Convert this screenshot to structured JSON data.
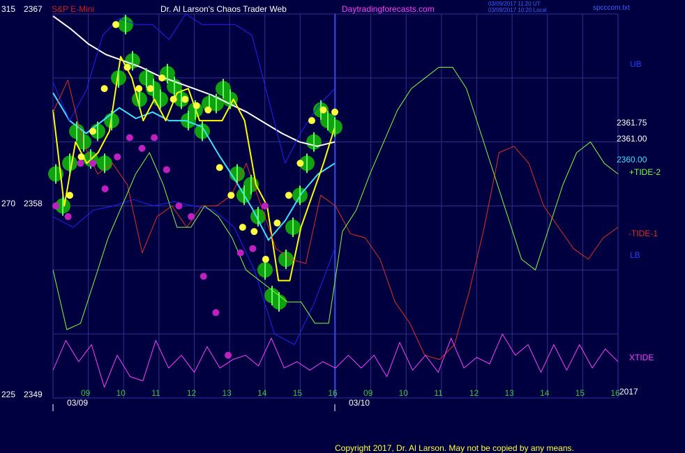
{
  "header": {
    "symbol": "S&P E-Mini",
    "title": "Dr. Al Larson's Chaos Trader Web",
    "site": "Daytradingforecasts.com",
    "stamp_line1": "03/09/2017 11:20 UT",
    "stamp_line2": "03/09/2017 10:20 Local",
    "file": "spcccom.txt",
    "colors": {
      "symbol": "#cc2020",
      "title": "#ffffff",
      "site": "#ff40ff",
      "stamp": "#4060ff",
      "file": "#4060ff"
    }
  },
  "footer": {
    "copyright": "Copyright 2017, Dr. Al Larson. May not be copied by any means."
  },
  "chart_data": {
    "type": "line",
    "y_left_labels": [
      {
        "label": "315",
        "price": "2367"
      },
      {
        "label": "270",
        "price": "2358"
      },
      {
        "label": "225",
        "price": "2349"
      }
    ],
    "ylim": [
      2349,
      2367
    ],
    "x_hours": [
      "09",
      "10",
      "11",
      "12",
      "13",
      "14",
      "15",
      "16",
      "09",
      "10",
      "11",
      "12",
      "13",
      "14",
      "15",
      "16"
    ],
    "x_dates": [
      "03/09",
      "03/10"
    ],
    "x_year": "2017",
    "price_labels": [
      {
        "text": "2361.75",
        "value": 2361.75,
        "color": "#ffffff"
      },
      {
        "text": "2361.00",
        "value": 2361.0,
        "color": "#ffffff"
      },
      {
        "text": "2360.00",
        "value": 2360.0,
        "color": "#40e0ff"
      }
    ],
    "right_labels": [
      {
        "text": "UB",
        "color": "#2040ff"
      },
      {
        "text": "+TIDE-2",
        "color": "#80ff40"
      },
      {
        "text": "-TIDE-1",
        "color": "#e03020"
      },
      {
        "text": "LB",
        "color": "#2040ff"
      },
      {
        "text": "XTIDE",
        "color": "#ff40ff"
      }
    ],
    "series": [
      {
        "color": "#ffffff",
        "values": [
          2366.9,
          2366.3,
          2365.6,
          2365.1,
          2364.8,
          2364.5,
          2364.1,
          2363.8,
          2363.5,
          2363.2,
          2362.8,
          2362.4,
          2361.9,
          2361.4,
          2361.0,
          2360.8,
          2361.0
        ]
      },
      {
        "color": "#40e0ff",
        "values": [
          2363.3,
          2362.0,
          2361.4,
          2362.0,
          2362.6,
          2362.1,
          2362.4,
          2362.0,
          2362.0,
          2361.7,
          2360.4,
          2359.2,
          2357.9,
          2356.4,
          2357.3,
          2358.6,
          2359.5,
          2360.0
        ]
      },
      {
        "color": "#ffff00",
        "values": [
          2362.5,
          2358.0,
          2361.0,
          2360.0,
          2360.5,
          2361.5,
          2365.0,
          2364.0,
          2362.0,
          2363.0,
          2362.0,
          2363.3,
          2363.5,
          2362.0,
          2362.0,
          2362.0,
          2363.0,
          2362.0,
          2359.0,
          2358.0,
          2354.5,
          2354.5,
          2357.0,
          2358.5,
          2360.0,
          2361.7
        ]
      },
      {
        "color": "#2020ff",
        "values": [
          2363.8,
          2362.0,
          2363.4,
          2366.0,
          2366.8,
          2366.5,
          2366.5,
          2365.8,
          2367.0,
          2366.5,
          2366.5,
          2366.5,
          2366.0,
          2363.0,
          2360.0,
          2361.5,
          2362.7,
          2363.5
        ]
      },
      {
        "color": "#2020ff",
        "values": [
          2357.5,
          2357.0,
          2357.8,
          2358.0,
          2358.3,
          2358.0,
          2358.2,
          2358.0,
          2357.8,
          2357.0,
          2355.0,
          2352.0,
          2351.5,
          2353.5,
          2356.0
        ]
      },
      {
        "color": "#e03020",
        "values": [
          2362.4,
          2363.9,
          2361.0,
          2359.5,
          2360.0,
          2359.0,
          2355.8,
          2357.5,
          2358.0,
          2357.0,
          2358.0,
          2358.0,
          2358.5,
          2360.0,
          2358.0,
          2356.0,
          2355.5,
          2355.3,
          2358.5,
          2358.0,
          2356.7,
          2356.5,
          2355.5,
          2353.5,
          2352.5,
          2351.0,
          2350.8,
          2351.5,
          2354.0,
          2357.0,
          2360.5,
          2360.8,
          2360.0,
          2358.0,
          2357.0,
          2356.0,
          2355.5,
          2356.5,
          2357.0
        ]
      },
      {
        "color": "#80ff40",
        "values": [
          2355.0,
          2352.2,
          2352.5,
          2354.5,
          2356.5,
          2358.0,
          2359.5,
          2360.5,
          2359.0,
          2357.0,
          2357.0,
          2358.0,
          2357.5,
          2356.5,
          2355.0,
          2354.5,
          2354.0,
          2353.5,
          2353.5,
          2352.5,
          2352.5,
          2356.8,
          2357.8,
          2359.5,
          2361.0,
          2362.5,
          2363.5,
          2364.0,
          2364.5,
          2364.5,
          2363.5,
          2361.5,
          2359.5,
          2357.5,
          2355.5,
          2355.0,
          2357.0,
          2359.0,
          2360.5,
          2361.0,
          2360.0,
          2359.5
        ]
      },
      {
        "color": "#ff40ff",
        "values": [
          2350.3,
          2351.7,
          2350.7,
          2351.5,
          2349.5,
          2351.0,
          2350.0,
          2349.8,
          2351.7,
          2350.4,
          2351.0,
          2350.2,
          2351.4,
          2350.4,
          2350.8,
          2351.0,
          2350.5,
          2351.8,
          2350.4,
          2350.7,
          2350.3,
          2350.7,
          2350.4,
          2351.0,
          2350.4,
          2351.0,
          2350.0,
          2351.6,
          2350.3,
          2351.0,
          2350.2,
          2351.8,
          2350.4,
          2350.9,
          2350.6,
          2352.0,
          2351.0,
          2351.5,
          2350.2,
          2351.5,
          2350.3,
          2351.5,
          2350.4,
          2351.3,
          2350.7
        ]
      }
    ],
    "price_bars": [
      2359.5,
      2358.0,
      2360.0,
      2361.5,
      2361.0,
      2360.2,
      2361.5,
      2360.0,
      2362.0,
      2364.0,
      2366.5,
      2364.8,
      2363.0,
      2364.0,
      2363.5,
      2363.0,
      2364.2,
      2363.6,
      2363.0,
      2362.0,
      2362.5,
      2361.5,
      2362.8,
      2362.8,
      2363.5,
      2363.0,
      2359.5,
      2358.5,
      2359.0,
      2357.5,
      2355.0,
      2353.8,
      2353.5,
      2355.5,
      2357.0,
      2358.5,
      2360.0,
      2361.0,
      2362.5,
      2362.0,
      2361.7
    ],
    "yellow_dots": [
      2358.5,
      2360.3,
      2361.5,
      2363.5,
      2366.5,
      2364.5,
      2363.5,
      2363.5,
      2364.0,
      2363.0,
      2363.0,
      2362.7,
      2362.5,
      2359.8,
      2358.5,
      2357.0,
      2356.8,
      2355.5,
      2357.2,
      2358.5,
      2360.0,
      2362.0,
      2362.5,
      2362.4
    ],
    "magenta_dots": [
      2358.0,
      2357.5,
      2360.0,
      2360.0,
      2358.8,
      2360.3,
      2361.2,
      2360.7,
      2361.2,
      2359.7,
      2358.0,
      2357.5,
      2354.7,
      2353.0,
      2351.0,
      2355.8,
      2356.0,
      2358.0
    ]
  }
}
